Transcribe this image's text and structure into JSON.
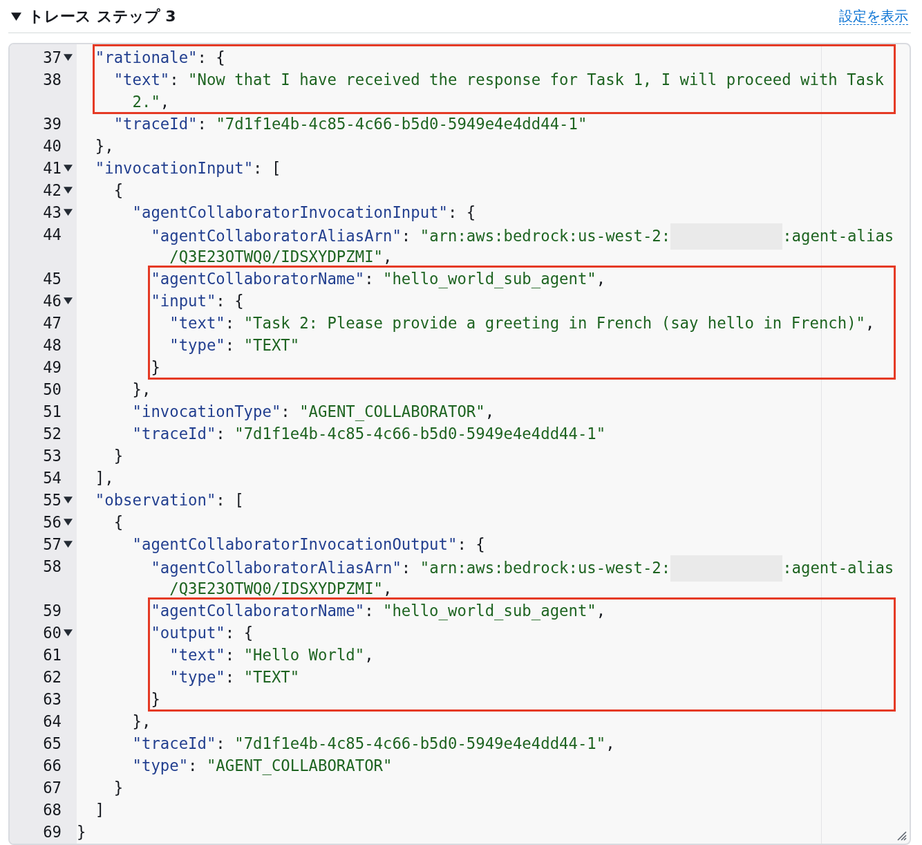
{
  "section": {
    "title": "トレース ステップ 3",
    "expanded": true,
    "link": "設定を表示"
  },
  "code": {
    "lines": [
      {
        "number": "37",
        "foldable": true,
        "highlighted": true,
        "tokens": [
          {
            "kind": "key",
            "text": "\"rationale\""
          },
          {
            "kind": "punct",
            "text": ": {"
          }
        ]
      },
      {
        "number": "38",
        "foldable": false,
        "highlighted": true,
        "tokens": [
          {
            "kind": "key",
            "text": "\"text\""
          },
          {
            "kind": "punct",
            "text": ": "
          },
          {
            "kind": "string",
            "text": "\"Now that I have received the response for Task 1, I will proceed with Task"
          },
          {
            "kind": "wrap"
          },
          {
            "kind": "string",
            "text": "2.\""
          },
          {
            "kind": "punct",
            "text": ","
          }
        ]
      },
      {
        "number": "39",
        "foldable": false,
        "highlighted": false,
        "tokens": [
          {
            "kind": "key",
            "text": "\"traceId\""
          },
          {
            "kind": "punct",
            "text": ": "
          },
          {
            "kind": "string",
            "text": "\"7d1f1e4b-4c85-4c66-b5d0-5949e4e4dd44-1\""
          }
        ]
      },
      {
        "number": "40",
        "foldable": false,
        "highlighted": false,
        "tokens": [
          {
            "kind": "punct",
            "text": "},"
          }
        ]
      },
      {
        "number": "41",
        "foldable": true,
        "highlighted": false,
        "tokens": [
          {
            "kind": "key",
            "text": "\"invocationInput\""
          },
          {
            "kind": "punct",
            "text": ": ["
          }
        ]
      },
      {
        "number": "42",
        "foldable": true,
        "highlighted": false,
        "tokens": [
          {
            "kind": "punct",
            "text": "{"
          }
        ]
      },
      {
        "number": "43",
        "foldable": true,
        "highlighted": false,
        "tokens": [
          {
            "kind": "key",
            "text": "\"agentCollaboratorInvocationInput\""
          },
          {
            "kind": "punct",
            "text": ": {"
          }
        ]
      },
      {
        "number": "44",
        "foldable": false,
        "highlighted": false,
        "tokens": [
          {
            "kind": "key",
            "text": "\"agentCollaboratorAliasArn\""
          },
          {
            "kind": "punct",
            "text": ": "
          },
          {
            "kind": "string",
            "text": "\"arn:aws:bedrock:us-west-2:"
          },
          {
            "kind": "redacted"
          },
          {
            "kind": "string",
            "text": ":agent-alias"
          },
          {
            "kind": "wrap"
          },
          {
            "kind": "string",
            "text": "/Q3E23OTWQ0/IDSXYDPZMI\""
          },
          {
            "kind": "punct",
            "text": ","
          }
        ]
      },
      {
        "number": "45",
        "foldable": false,
        "highlighted": true,
        "tokens": [
          {
            "kind": "key",
            "text": "\"agentCollaboratorName\""
          },
          {
            "kind": "punct",
            "text": ": "
          },
          {
            "kind": "string",
            "text": "\"hello_world_sub_agent\""
          },
          {
            "kind": "punct",
            "text": ","
          }
        ]
      },
      {
        "number": "46",
        "foldable": true,
        "highlighted": true,
        "tokens": [
          {
            "kind": "key",
            "text": "\"input\""
          },
          {
            "kind": "punct",
            "text": ": {"
          }
        ]
      },
      {
        "number": "47",
        "foldable": false,
        "highlighted": true,
        "tokens": [
          {
            "kind": "key",
            "text": "\"text\""
          },
          {
            "kind": "punct",
            "text": ": "
          },
          {
            "kind": "string",
            "text": "\"Task 2: Please provide a greeting in French (say hello in French)\""
          },
          {
            "kind": "punct",
            "text": ","
          }
        ]
      },
      {
        "number": "48",
        "foldable": false,
        "highlighted": true,
        "tokens": [
          {
            "kind": "key",
            "text": "\"type\""
          },
          {
            "kind": "punct",
            "text": ": "
          },
          {
            "kind": "string",
            "text": "\"TEXT\""
          }
        ]
      },
      {
        "number": "49",
        "foldable": false,
        "highlighted": true,
        "tokens": [
          {
            "kind": "punct",
            "text": "}"
          }
        ]
      },
      {
        "number": "50",
        "foldable": false,
        "highlighted": false,
        "tokens": [
          {
            "kind": "punct",
            "text": "},"
          }
        ]
      },
      {
        "number": "51",
        "foldable": false,
        "highlighted": false,
        "tokens": [
          {
            "kind": "key",
            "text": "\"invocationType\""
          },
          {
            "kind": "punct",
            "text": ": "
          },
          {
            "kind": "string",
            "text": "\"AGENT_COLLABORATOR\""
          },
          {
            "kind": "punct",
            "text": ","
          }
        ]
      },
      {
        "number": "52",
        "foldable": false,
        "highlighted": false,
        "tokens": [
          {
            "kind": "key",
            "text": "\"traceId\""
          },
          {
            "kind": "punct",
            "text": ": "
          },
          {
            "kind": "string",
            "text": "\"7d1f1e4b-4c85-4c66-b5d0-5949e4e4dd44-1\""
          }
        ]
      },
      {
        "number": "53",
        "foldable": false,
        "highlighted": false,
        "tokens": [
          {
            "kind": "punct",
            "text": "}"
          }
        ]
      },
      {
        "number": "54",
        "foldable": false,
        "highlighted": false,
        "tokens": [
          {
            "kind": "punct",
            "text": "],"
          }
        ]
      },
      {
        "number": "55",
        "foldable": true,
        "highlighted": false,
        "tokens": [
          {
            "kind": "key",
            "text": "\"observation\""
          },
          {
            "kind": "punct",
            "text": ": ["
          }
        ]
      },
      {
        "number": "56",
        "foldable": true,
        "highlighted": false,
        "tokens": [
          {
            "kind": "punct",
            "text": "{"
          }
        ]
      },
      {
        "number": "57",
        "foldable": true,
        "highlighted": false,
        "tokens": [
          {
            "kind": "key",
            "text": "\"agentCollaboratorInvocationOutput\""
          },
          {
            "kind": "punct",
            "text": ": {"
          }
        ]
      },
      {
        "number": "58",
        "foldable": false,
        "highlighted": false,
        "tokens": [
          {
            "kind": "key",
            "text": "\"agentCollaboratorAliasArn\""
          },
          {
            "kind": "punct",
            "text": ": "
          },
          {
            "kind": "string",
            "text": "\"arn:aws:bedrock:us-west-2:"
          },
          {
            "kind": "redacted"
          },
          {
            "kind": "string",
            "text": ":agent-alias"
          },
          {
            "kind": "wrap"
          },
          {
            "kind": "string",
            "text": "/Q3E23OTWQ0/IDSXYDPZMI\""
          },
          {
            "kind": "punct",
            "text": ","
          }
        ]
      },
      {
        "number": "59",
        "foldable": false,
        "highlighted": true,
        "tokens": [
          {
            "kind": "key",
            "text": "\"agentCollaboratorName\""
          },
          {
            "kind": "punct",
            "text": ": "
          },
          {
            "kind": "string",
            "text": "\"hello_world_sub_agent\""
          },
          {
            "kind": "punct",
            "text": ","
          }
        ]
      },
      {
        "number": "60",
        "foldable": true,
        "highlighted": true,
        "tokens": [
          {
            "kind": "key",
            "text": "\"output\""
          },
          {
            "kind": "punct",
            "text": ": {"
          }
        ]
      },
      {
        "number": "61",
        "foldable": false,
        "highlighted": true,
        "tokens": [
          {
            "kind": "key",
            "text": "\"text\""
          },
          {
            "kind": "punct",
            "text": ": "
          },
          {
            "kind": "string",
            "text": "\"Hello World\""
          },
          {
            "kind": "punct",
            "text": ","
          }
        ]
      },
      {
        "number": "62",
        "foldable": false,
        "highlighted": true,
        "tokens": [
          {
            "kind": "key",
            "text": "\"type\""
          },
          {
            "kind": "punct",
            "text": ": "
          },
          {
            "kind": "string",
            "text": "\"TEXT\""
          }
        ]
      },
      {
        "number": "63",
        "foldable": false,
        "highlighted": true,
        "tokens": [
          {
            "kind": "punct",
            "text": "}"
          }
        ]
      },
      {
        "number": "64",
        "foldable": false,
        "highlighted": false,
        "tokens": [
          {
            "kind": "punct",
            "text": "},"
          }
        ]
      },
      {
        "number": "65",
        "foldable": false,
        "highlighted": false,
        "tokens": [
          {
            "kind": "key",
            "text": "\"traceId\""
          },
          {
            "kind": "punct",
            "text": ": "
          },
          {
            "kind": "string",
            "text": "\"7d1f1e4b-4c85-4c66-b5d0-5949e4e4dd44-1\""
          },
          {
            "kind": "punct",
            "text": ","
          }
        ]
      },
      {
        "number": "66",
        "foldable": false,
        "highlighted": false,
        "tokens": [
          {
            "kind": "key",
            "text": "\"type\""
          },
          {
            "kind": "punct",
            "text": ": "
          },
          {
            "kind": "string",
            "text": "\"AGENT_COLLABORATOR\""
          }
        ]
      },
      {
        "number": "67",
        "foldable": false,
        "highlighted": false,
        "tokens": [
          {
            "kind": "punct",
            "text": "}"
          }
        ]
      },
      {
        "number": "68",
        "foldable": false,
        "highlighted": false,
        "tokens": [
          {
            "kind": "punct",
            "text": "]"
          }
        ]
      },
      {
        "number": "69",
        "foldable": false,
        "highlighted": false,
        "tokens": [
          {
            "kind": "punct",
            "text": "}"
          }
        ]
      }
    ]
  }
}
